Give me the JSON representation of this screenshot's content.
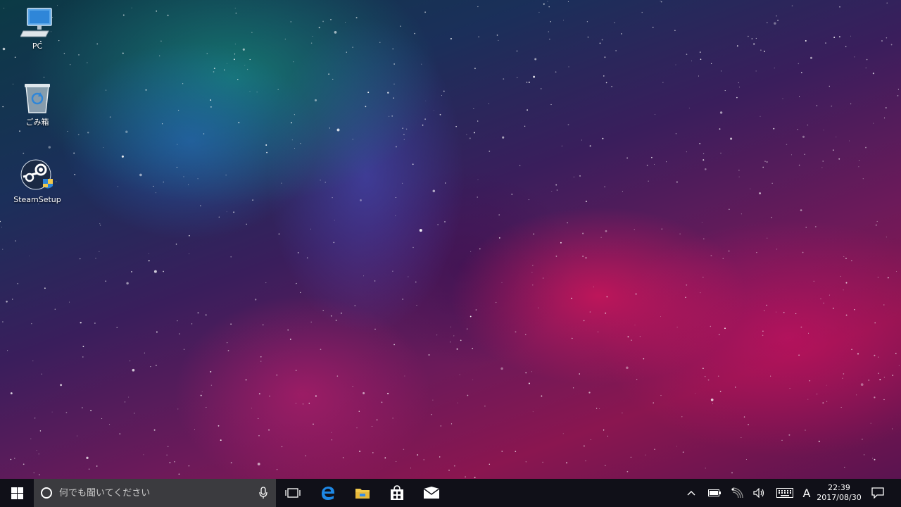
{
  "desktop": {
    "icons": [
      {
        "name": "pc-icon",
        "label": "PC",
        "icon": "computer-monitor"
      },
      {
        "name": "recycle-bin-icon",
        "label": "ごみ箱",
        "icon": "recycle-bin"
      },
      {
        "name": "steam-setup-icon",
        "label": "SteamSetup",
        "icon": "steam-logo-with-shield"
      }
    ]
  },
  "taskbar": {
    "start_icon": "windows-logo",
    "search": {
      "placeholder": "何でも聞いてください",
      "value": ""
    },
    "pinned": [
      "task-view",
      "edge",
      "file-explorer",
      "store",
      "mail"
    ],
    "tray": {
      "ime_mode": "A",
      "time": "22:39",
      "date": "2017/08/30"
    }
  },
  "colors": {
    "taskbar_bg": "#101018",
    "search_bg": "#3b3b3f",
    "edge_blue": "#1e88e5",
    "explorer_yellow": "#f2c94c"
  }
}
